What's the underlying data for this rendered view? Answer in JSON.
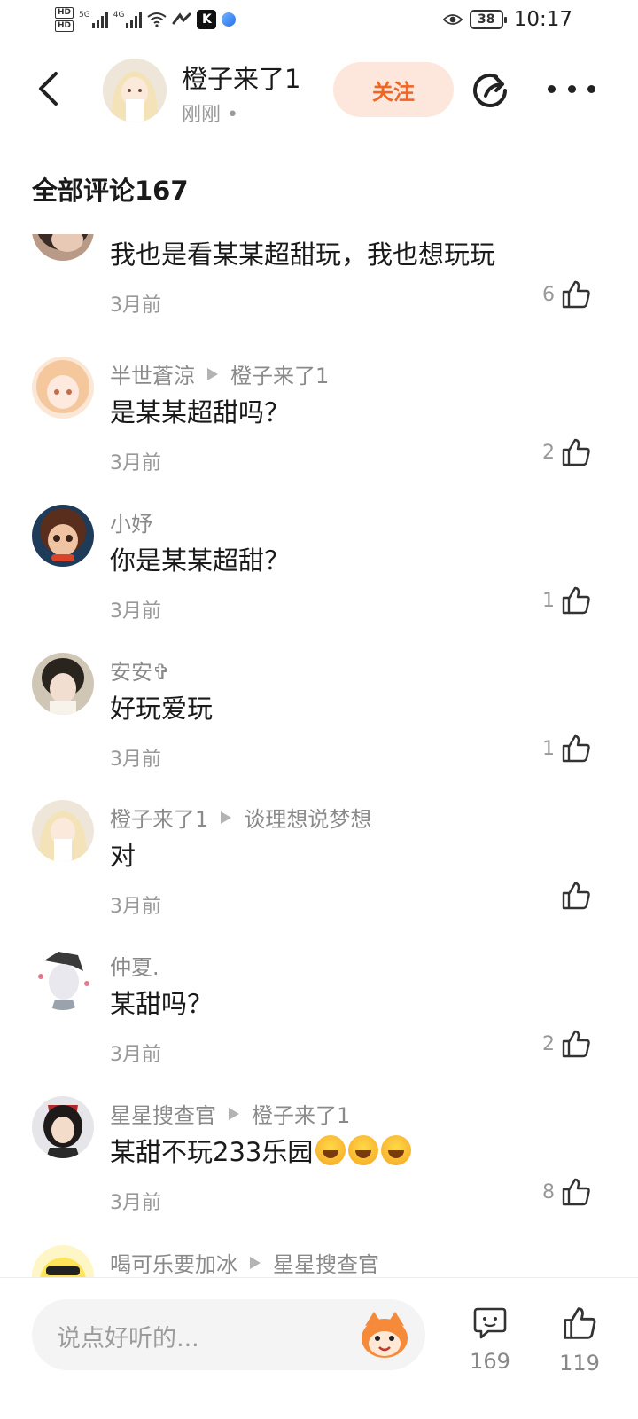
{
  "status_bar": {
    "left_badges": [
      "HD",
      "HD"
    ],
    "signal_label_1": "5G",
    "signal_label_2": "4G",
    "k_badge": "K",
    "battery": "38",
    "time": "10:17",
    "icons": [
      "signal-icon",
      "wifi-icon",
      "nfc-icon",
      "k-app-icon",
      "app-dot-icon",
      "eye-icon",
      "battery-icon"
    ]
  },
  "header": {
    "author_name": "橙子来了1",
    "post_time": "刚刚 •",
    "follow_label": "关注",
    "icons": [
      "back-icon",
      "share-icon",
      "more-icon"
    ]
  },
  "section": {
    "title": "全部评论167"
  },
  "comments": [
    {
      "author": "",
      "reply_to": "",
      "text": "我也是看某某超甜玩，我也想玩玩",
      "date": "3月前",
      "likes": "6"
    },
    {
      "author": "半世蒼涼",
      "reply_to": "橙子来了1",
      "text": "是某某超甜吗？",
      "date": "3月前",
      "likes": "2"
    },
    {
      "author": "小妤",
      "reply_to": "",
      "text": "你是某某超甜？",
      "date": "3月前",
      "likes": "1"
    },
    {
      "author": "安安✞",
      "reply_to": "",
      "text": "好玩爱玩",
      "date": "3月前",
      "likes": "1"
    },
    {
      "author": "橙子来了1",
      "reply_to": "谈理想说梦想",
      "text": "对",
      "date": "3月前",
      "likes": ""
    },
    {
      "author": "仲夏.",
      "reply_to": "",
      "text": "某甜吗？",
      "date": "3月前",
      "likes": "2"
    },
    {
      "author": "星星搜查官",
      "reply_to": "橙子来了1",
      "text": "某甜不玩233乐园",
      "emoji_count": 3,
      "date": "3月前",
      "likes": "8"
    },
    {
      "author": "喝可乐要加冰",
      "reply_to": "星星搜查官",
      "text": "",
      "date": "",
      "likes": ""
    }
  ],
  "bottom_bar": {
    "input_placeholder": "说点好听的...",
    "comment_count": "169",
    "like_count": "119"
  },
  "colors": {
    "accent": "#f06424",
    "follow_bg": "#fde7dc",
    "muted_text": "#999999"
  }
}
